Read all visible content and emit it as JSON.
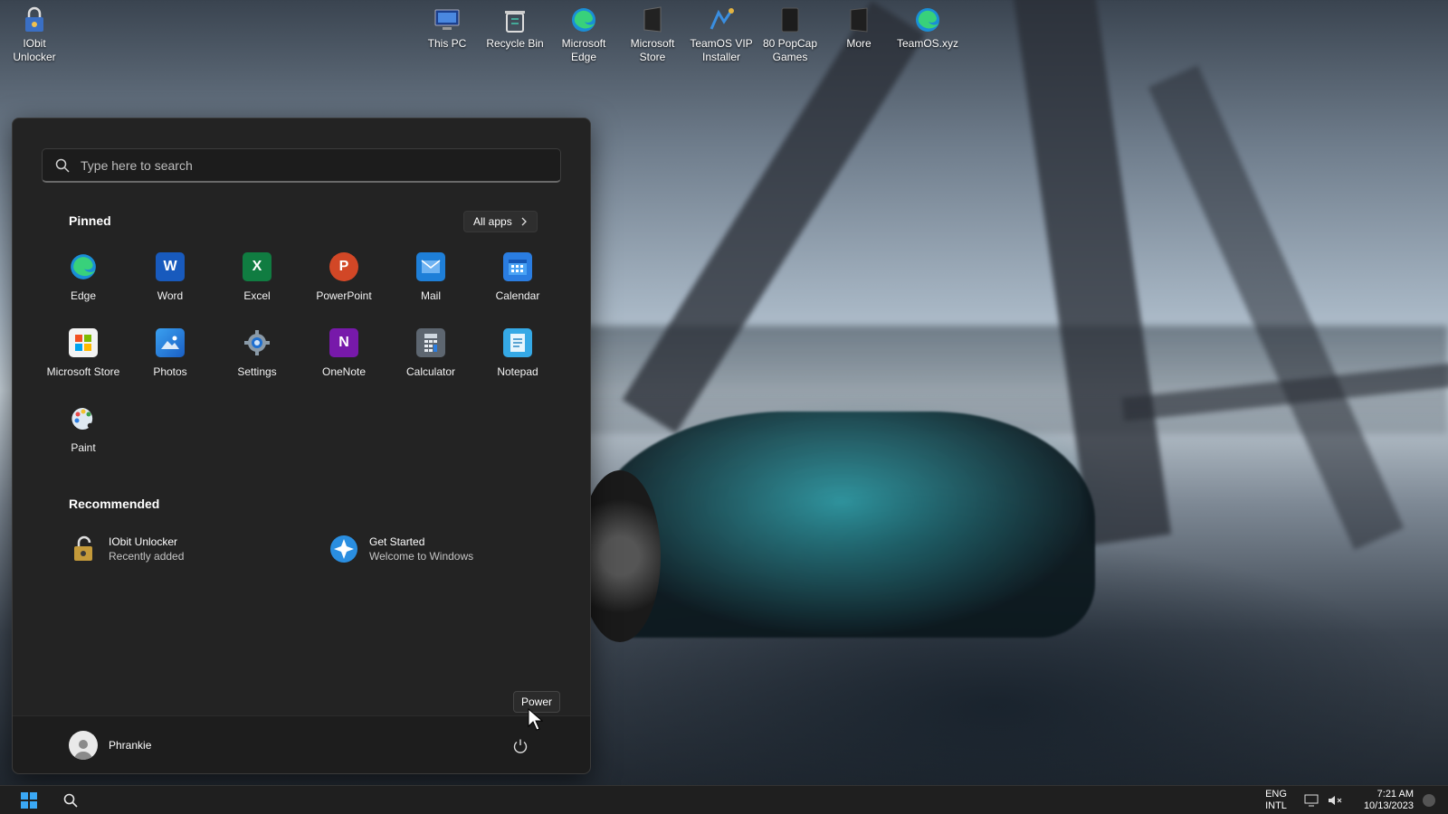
{
  "desktop": {
    "icons": [
      {
        "label": "IObit Unlocker",
        "icon": "iobit-unlocker-icon"
      },
      {
        "label": "This PC",
        "icon": "this-pc-icon"
      },
      {
        "label": "Recycle Bin",
        "icon": "recycle-bin-icon"
      },
      {
        "label": "Microsoft Edge",
        "icon": "edge-icon"
      },
      {
        "label": "Microsoft Store",
        "icon": "store-icon"
      },
      {
        "label": "TeamOS VIP Installer",
        "icon": "installer-icon"
      },
      {
        "label": "80 PopCap Games",
        "icon": "games-folder-icon"
      },
      {
        "label": "More",
        "icon": "folder-icon"
      },
      {
        "label": "TeamOS.xyz",
        "icon": "edge-icon"
      }
    ]
  },
  "start_menu": {
    "search": {
      "placeholder": "Type here to search"
    },
    "pinned_title": "Pinned",
    "all_apps_label": "All apps",
    "pinned_apps": [
      {
        "label": "Edge",
        "icon": "edge-icon"
      },
      {
        "label": "Word",
        "icon": "word-icon"
      },
      {
        "label": "Excel",
        "icon": "excel-icon"
      },
      {
        "label": "PowerPoint",
        "icon": "powerpoint-icon"
      },
      {
        "label": "Mail",
        "icon": "mail-icon"
      },
      {
        "label": "Calendar",
        "icon": "calendar-icon"
      },
      {
        "label": "Microsoft Store",
        "icon": "store-icon"
      },
      {
        "label": "Photos",
        "icon": "photos-icon"
      },
      {
        "label": "Settings",
        "icon": "gear-icon"
      },
      {
        "label": "OneNote",
        "icon": "onenote-icon"
      },
      {
        "label": "Calculator",
        "icon": "calculator-icon"
      },
      {
        "label": "Notepad",
        "icon": "notepad-icon"
      },
      {
        "label": "Paint",
        "icon": "paint-icon"
      }
    ],
    "recommended_title": "Recommended",
    "recommended": [
      {
        "title": "IObit Unlocker",
        "subtitle": "Recently added",
        "icon": "iobit-unlocker-icon"
      },
      {
        "title": "Get Started",
        "subtitle": "Welcome to Windows",
        "icon": "get-started-icon"
      }
    ],
    "user_name": "Phrankie",
    "power_tooltip": "Power"
  },
  "taskbar": {
    "language_line1": "ENG",
    "language_line2": "INTL",
    "time": "7:21 AM",
    "date": "10/13/2023"
  },
  "colors": {
    "start_bg": "#232323",
    "taskbar_bg": "#1f1f1f",
    "accent": "#0078d4"
  }
}
